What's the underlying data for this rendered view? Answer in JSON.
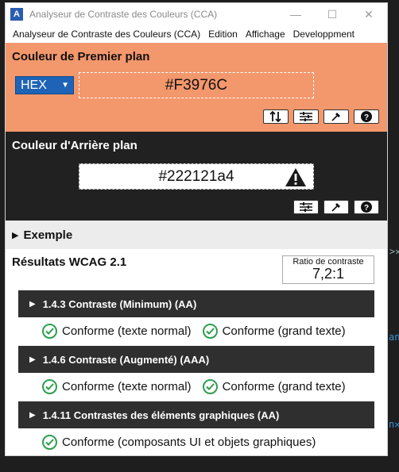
{
  "window": {
    "title": "Analyseur de Contraste des Couleurs (CCA)",
    "controls": [
      "—",
      "☐",
      "✕"
    ]
  },
  "menu": [
    "Analyseur de Contraste des Couleurs (CCA)",
    "Edition",
    "Affichage",
    "Developpment"
  ],
  "foreground": {
    "title": "Couleur de Premier plan",
    "format": "HEX",
    "value": "#F3976C",
    "color": "#f3976c"
  },
  "background": {
    "title": "Couleur d'Arrière plan",
    "value": "#222121a4",
    "color": "#222121"
  },
  "example": {
    "label": "Exemple"
  },
  "results": {
    "title": "Résultats WCAG 2.1",
    "ratio_label": "Ratio de contraste",
    "ratio_value": "7,2:1",
    "criteria": [
      {
        "label": "1.4.3 Contraste (Minimum) (AA)",
        "results": [
          "Conforme (texte normal)",
          "Conforme (grand texte)"
        ]
      },
      {
        "label": "1.4.6 Contraste (Augmenté) (AAA)",
        "results": [
          "Conforme (texte normal)",
          "Conforme (grand texte)"
        ]
      },
      {
        "label": "1.4.11 Contrastes des éléments graphiques (AA)",
        "results": [
          "Conforme (composants UI et objets graphiques)"
        ]
      }
    ]
  },
  "editor_fragments": [
    ">✕",
    "an",
    "n✕"
  ]
}
